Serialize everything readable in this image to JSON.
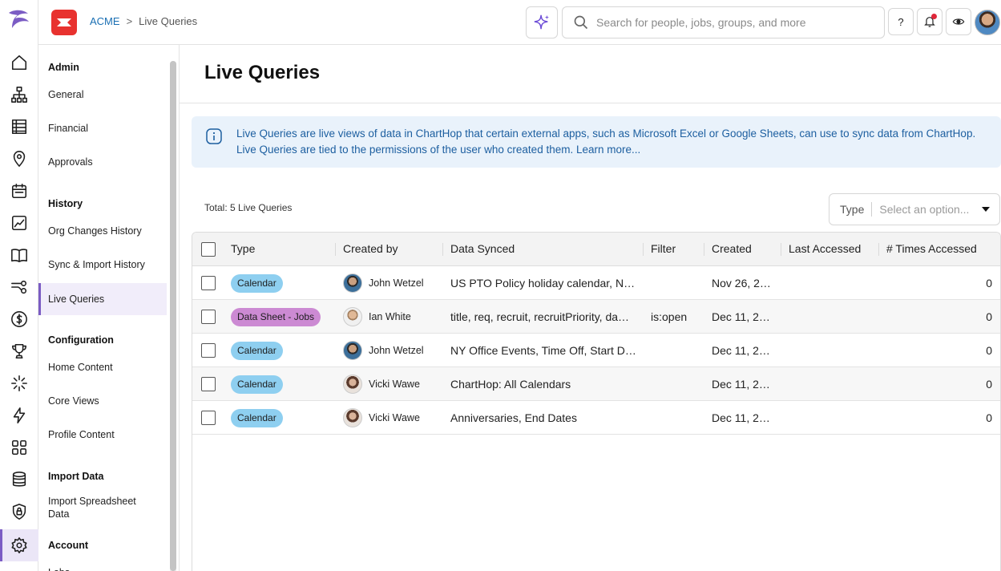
{
  "header": {
    "breadcrumb_org": "ACME",
    "breadcrumb_sep": ">",
    "breadcrumb_page": "Live Queries",
    "search_placeholder": "Search for people, jobs, groups, and more",
    "help_label": "?"
  },
  "rail": {
    "icons": [
      "home-icon",
      "org-chart-icon",
      "table-icon",
      "location-pin-icon",
      "calendar-icon",
      "analytics-icon",
      "book-icon",
      "workflow-icon",
      "dollar-icon",
      "trophy-icon",
      "sparkle-burst-icon",
      "lightning-icon",
      "apps-grid-icon",
      "database-icon",
      "shield-lock-icon",
      "settings-gear-icon"
    ],
    "active": "settings-gear-icon"
  },
  "sidebar": {
    "sections": [
      {
        "title": "Admin",
        "items": [
          "General",
          "Financial",
          "Approvals"
        ]
      },
      {
        "title": "History",
        "items": [
          "Org Changes History",
          "Sync & Import History",
          "Live Queries"
        ]
      },
      {
        "title": "Configuration",
        "items": [
          "Home Content",
          "Core Views",
          "Profile Content"
        ]
      },
      {
        "title": "Import Data",
        "items": [
          "Import Spreadsheet Data"
        ]
      },
      {
        "title": "Account",
        "items": [
          "Labs"
        ]
      }
    ],
    "active_item": "Live Queries"
  },
  "page": {
    "title": "Live Queries",
    "banner_text": "Live Queries are live views of data in ChartHop that certain external apps, such as Microsoft Excel or Google Sheets, can use to sync data from ChartHop. Live Queries are tied to the permissions of the user who created them. Learn more...",
    "total": "Total: 5 Live Queries",
    "type_filter_label": "Type",
    "type_filter_placeholder": "Select an option..."
  },
  "table": {
    "columns": [
      "Type",
      "Created by",
      "Data Synced",
      "Filter",
      "Created",
      "Last Accessed",
      "# Times Accessed"
    ],
    "rows": [
      {
        "type": "Calendar",
        "type_color": "#8ecff0",
        "avatar": "jw",
        "created_by": "John Wetzel",
        "data_synced": "US PTO Policy holiday calendar, N…",
        "filter": "",
        "created": "Nov 26, 2…",
        "last_accessed": "",
        "times": "0"
      },
      {
        "type": "Data Sheet - Jobs",
        "type_color": "#cc8ad3",
        "avatar": "iw",
        "created_by": "Ian White",
        "data_synced": "title, req, recruit, recruitPriority, da…",
        "filter": "is:open",
        "created": "Dec 11, 2…",
        "last_accessed": "",
        "times": "0"
      },
      {
        "type": "Calendar",
        "type_color": "#8ecff0",
        "avatar": "jw",
        "created_by": "John Wetzel",
        "data_synced": "NY Office Events, Time Off, Start D…",
        "filter": "",
        "created": "Dec 11, 2…",
        "last_accessed": "",
        "times": "0"
      },
      {
        "type": "Calendar",
        "type_color": "#8ecff0",
        "avatar": "vw",
        "created_by": "Vicki Wawe",
        "data_synced": "ChartHop: All Calendars",
        "filter": "",
        "created": "Dec 11, 2…",
        "last_accessed": "",
        "times": "0"
      },
      {
        "type": "Calendar",
        "type_color": "#8ecff0",
        "avatar": "vw",
        "created_by": "Vicki Wawe",
        "data_synced": "Anniversaries, End Dates",
        "filter": "",
        "created": "Dec 11, 2…",
        "last_accessed": "",
        "times": "0"
      }
    ]
  }
}
